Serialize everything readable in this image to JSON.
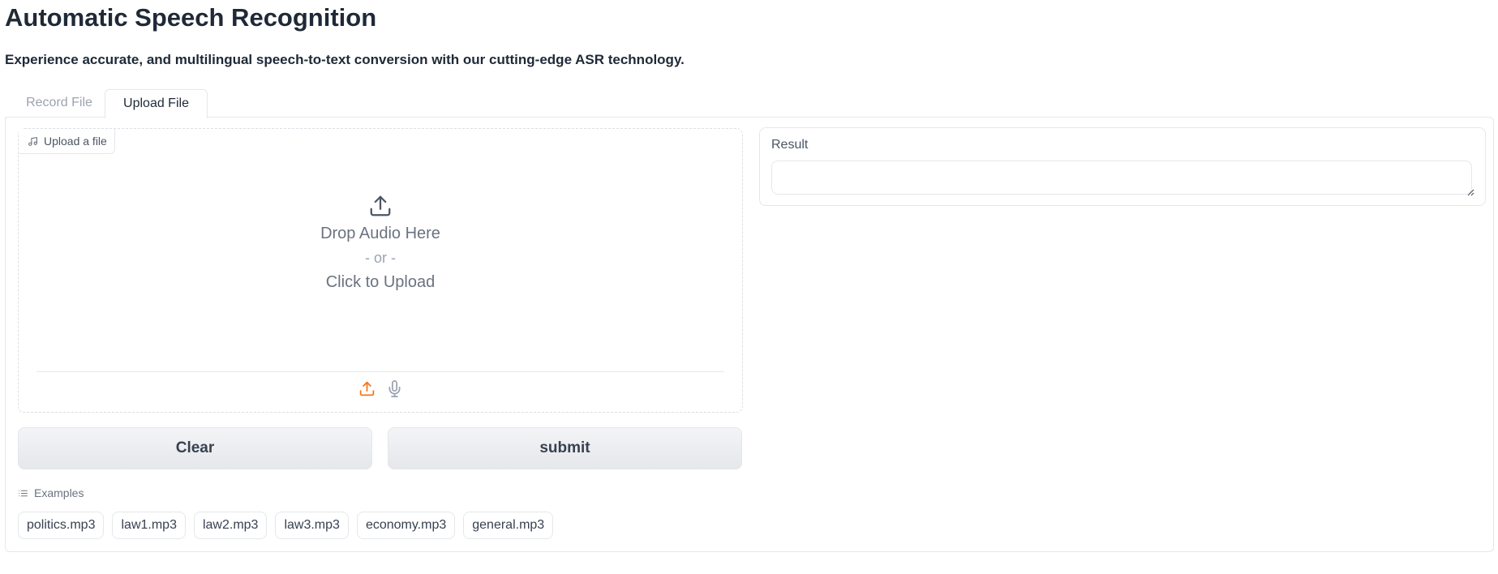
{
  "header": {
    "title": "Automatic Speech Recognition",
    "subtitle": "Experience accurate, and multilingual speech-to-text conversion with our cutting-edge ASR technology."
  },
  "tabs": [
    {
      "label": "Record File",
      "active": false
    },
    {
      "label": "Upload File",
      "active": true
    }
  ],
  "upload": {
    "label": "Upload a file",
    "label_icon": "music-note-icon",
    "drop_text": "Drop Audio Here",
    "or_text": "- or -",
    "click_text": "Click to Upload",
    "sources": [
      {
        "name": "upload-icon",
        "active": true
      },
      {
        "name": "microphone-icon",
        "active": false
      }
    ]
  },
  "buttons": {
    "clear_label": "Clear",
    "submit_label": "submit"
  },
  "examples": {
    "header": "Examples",
    "items": [
      "politics.mp3",
      "law1.mp3",
      "law2.mp3",
      "law3.mp3",
      "economy.mp3",
      "general.mp3"
    ]
  },
  "result": {
    "label": "Result",
    "value": ""
  },
  "colors": {
    "accent": "#f97316",
    "text": "#1f2937",
    "muted": "#9ca3af",
    "border": "#e5e7eb"
  }
}
